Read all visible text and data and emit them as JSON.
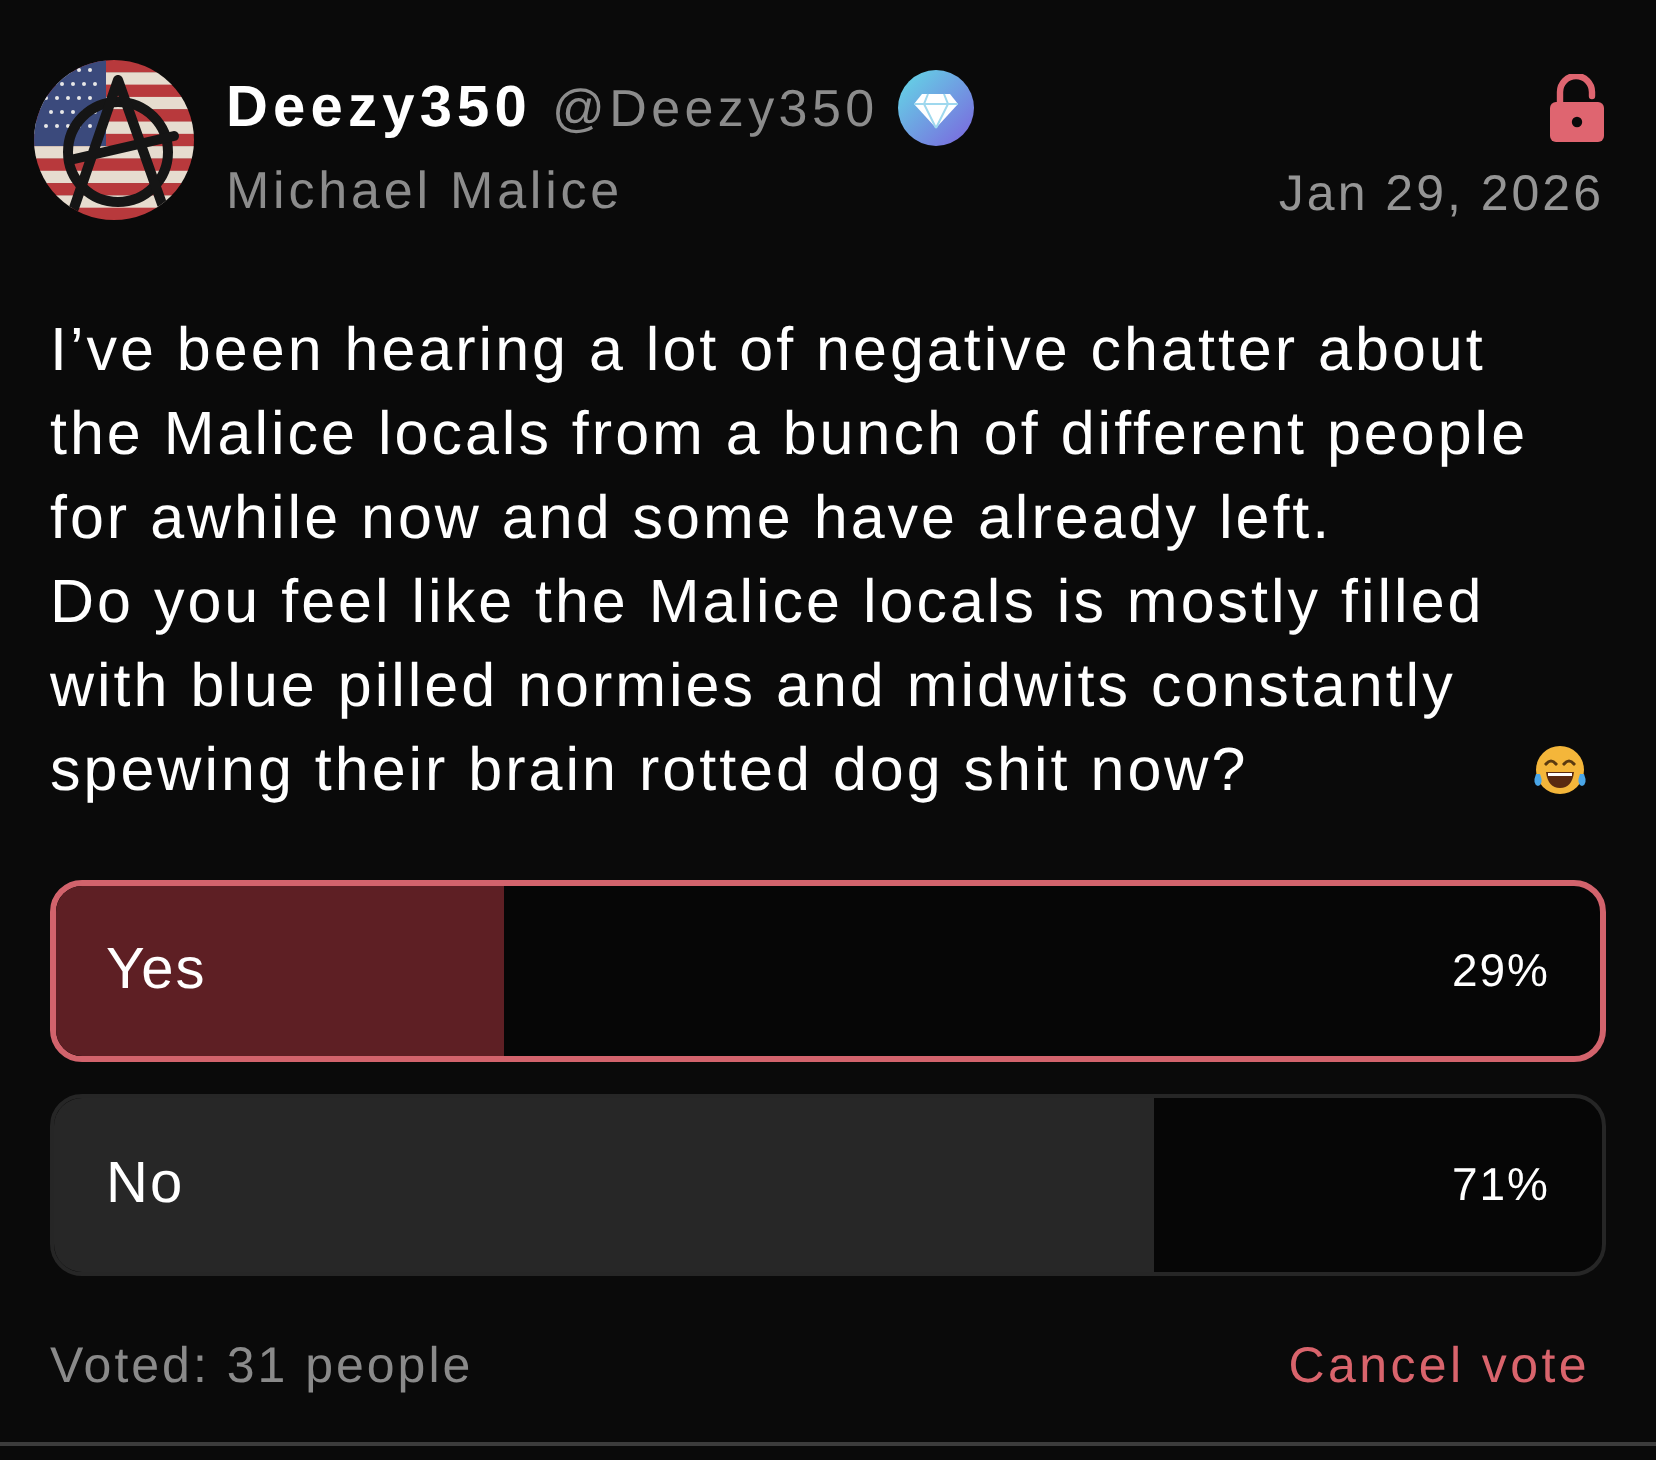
{
  "post": {
    "author": {
      "name": "Deezy350",
      "handle": "@Deezy350",
      "subtitle": "Michael Malice"
    },
    "date": "Jan 29, 2026",
    "body": [
      "I’ve been hearing a lot of negative chatter about the Malice locals from a bunch of different people for awhile now and some have already left.",
      "Do you feel like the Malice locals is mostly filled with blue pilled normies and midwits constantly spewing their brain rotted dog shit now?"
    ]
  },
  "poll": {
    "options": [
      {
        "label": "Yes",
        "percent": "29%",
        "level": 0.29,
        "selected": true
      },
      {
        "label": "No",
        "percent": "71%",
        "level": 0.71,
        "selected": false
      }
    ],
    "voted": "Voted: 31 people",
    "cancel": "Cancel vote"
  }
}
